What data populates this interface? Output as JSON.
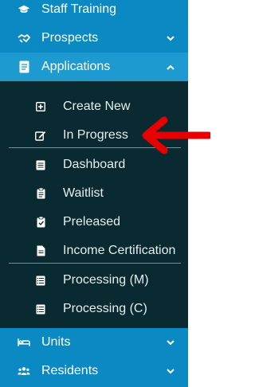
{
  "sidebar": {
    "items": [
      {
        "label": "Staff Training",
        "icon": "graduation-cap-icon"
      },
      {
        "label": "Prospects",
        "icon": "handshake-icon",
        "chevron": "chevron-down-icon"
      },
      {
        "label": "Applications",
        "icon": "file-icon",
        "chevron": "chevron-up-icon"
      },
      {
        "label": "Units",
        "icon": "bed-icon",
        "chevron": "chevron-down-icon"
      },
      {
        "label": "Residents",
        "icon": "users-icon",
        "chevron": "chevron-down-icon"
      }
    ],
    "applications_submenu": [
      {
        "label": "Create New",
        "icon": "plus-square-icon"
      },
      {
        "label": "In Progress",
        "icon": "edit-icon"
      },
      {
        "label": "Dashboard",
        "icon": "list-alt-icon"
      },
      {
        "label": "Waitlist",
        "icon": "clipboard-icon"
      },
      {
        "label": "Preleased",
        "icon": "clipboard-check-icon"
      },
      {
        "label": "Income Certification",
        "icon": "file-alt-icon"
      },
      {
        "label": "Processing (M)",
        "icon": "list-icon"
      },
      {
        "label": "Processing (C)",
        "icon": "list-ol-icon"
      }
    ]
  },
  "colors": {
    "sidebar_bg": "#0b89c3",
    "active_bg": "#1d9ad0",
    "submenu_bg": "#082a30",
    "annotation_arrow": "#e60000"
  }
}
